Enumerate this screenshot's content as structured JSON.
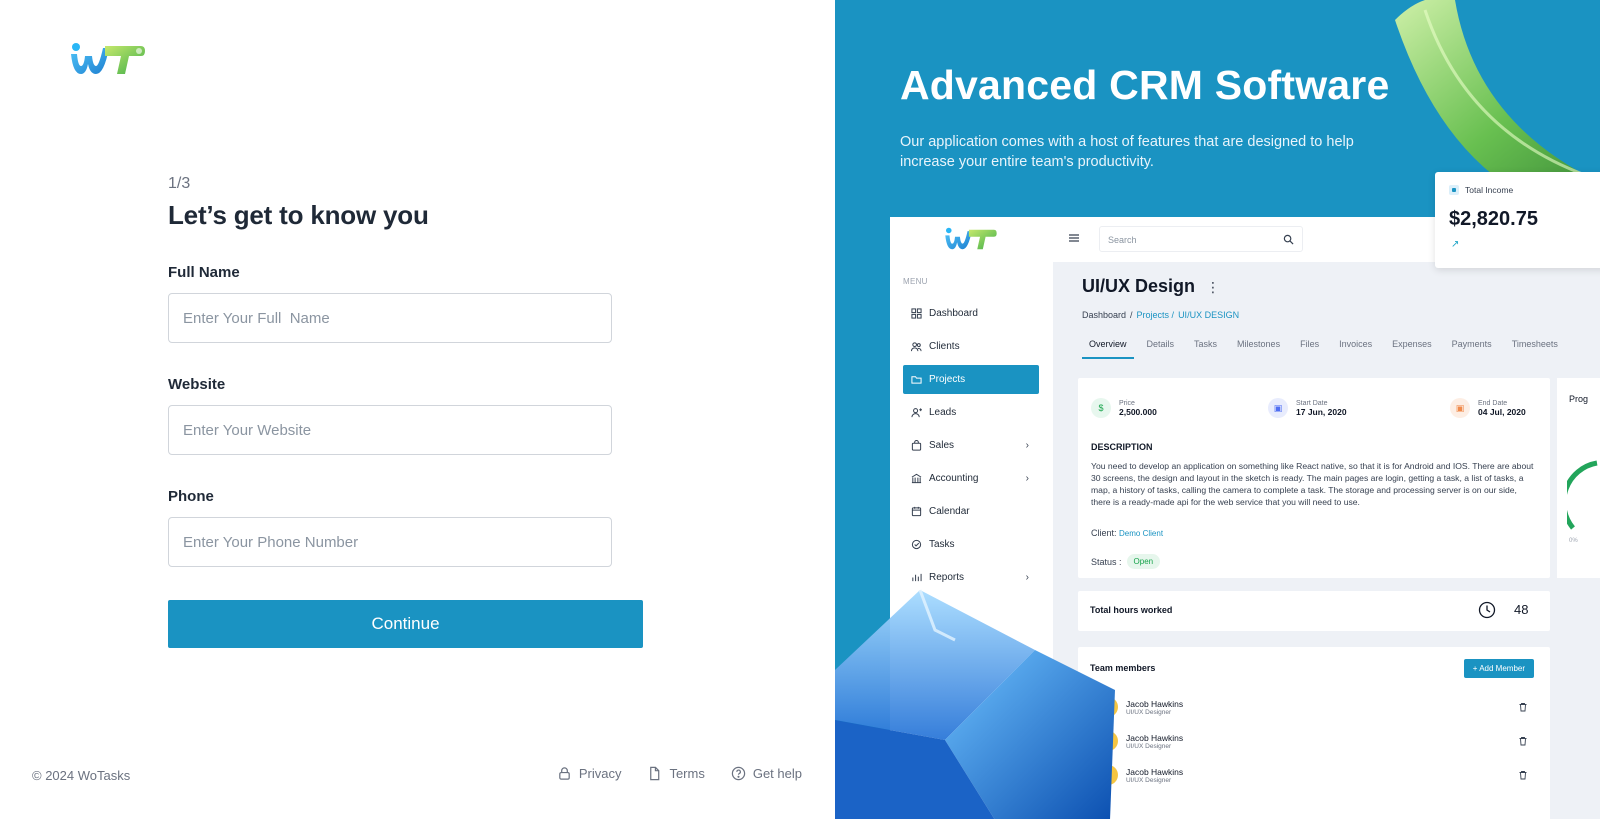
{
  "brand": {
    "logo_text": "WT",
    "copyright": "© 2024 WoTasks"
  },
  "form": {
    "step": "1/3",
    "title": "Let’s get to know you",
    "fields": [
      {
        "label": "Full Name",
        "placeholder": "Enter Your Full  Name"
      },
      {
        "label": "Website",
        "placeholder": "Enter Your Website"
      },
      {
        "label": "Phone",
        "placeholder": "Enter Your Phone Number"
      }
    ],
    "continue_label": "Continue"
  },
  "footer": {
    "links": [
      {
        "label": "Privacy",
        "icon": "lock-icon"
      },
      {
        "label": "Terms",
        "icon": "document-icon"
      },
      {
        "label": "Get help",
        "icon": "help-circle-icon"
      }
    ]
  },
  "hero": {
    "title": "Advanced CRM Software",
    "subtitle": "Our application comes with a host of features that are designed to help increase your entire team's productivity."
  },
  "mockup": {
    "menu_label": "MENU",
    "nav": [
      {
        "label": "Dashboard",
        "icon": "grid-icon",
        "active": false,
        "chevron": false
      },
      {
        "label": "Clients",
        "icon": "users-icon",
        "active": false,
        "chevron": false
      },
      {
        "label": "Projects",
        "icon": "folder-icon",
        "active": true,
        "chevron": false
      },
      {
        "label": "Leads",
        "icon": "user-plus-icon",
        "active": false,
        "chevron": false
      },
      {
        "label": "Sales",
        "icon": "bag-icon",
        "active": false,
        "chevron": true
      },
      {
        "label": "Accounting",
        "icon": "bank-icon",
        "active": false,
        "chevron": true
      },
      {
        "label": "Calendar",
        "icon": "calendar-icon",
        "active": false,
        "chevron": false
      },
      {
        "label": "Tasks",
        "icon": "check-circle-icon",
        "active": false,
        "chevron": false
      },
      {
        "label": "Reports",
        "icon": "chart-icon",
        "active": false,
        "chevron": true
      }
    ],
    "search_placeholder": "Search",
    "page_title": "UI/UX Design",
    "breadcrumb": {
      "home": "Dashboard",
      "sep": "/",
      "mid": "Projects /",
      "current": "UI/UX DESIGN"
    },
    "tabs": [
      "Overview",
      "Details",
      "Tasks",
      "Milestones",
      "Files",
      "Invoices",
      "Expenses",
      "Payments",
      "Timesheets"
    ],
    "stats": [
      {
        "label": "Price",
        "value": "2,500.000",
        "icon": "dollar-icon",
        "color": "#16a34a",
        "bg": "#e7f7ee"
      },
      {
        "label": "Start Date",
        "value": "17 Jun, 2020",
        "icon": "calendar-icon",
        "color": "#4f6ef2",
        "bg": "#e8ecfd"
      },
      {
        "label": "End Date",
        "value": "04 Jul, 2020",
        "icon": "calendar-icon",
        "color": "#f08a4b",
        "bg": "#fdeee4"
      }
    ],
    "description_title": "DESCRIPTION",
    "description": "You need to develop an application on something like React native, so that it is for Android and IOS. There are about 30 screens, the design and layout in the sketch is ready. The main pages are login, getting a task, a list of tasks, a map, a history of tasks, calling the camera to complete a task. The storage and processing server is on our side, there is a ready-made api for the web service that you will need to use.",
    "client_label": "Client:",
    "client_value": "Demo Client",
    "status_label": "Status :",
    "status_value": "Open",
    "hours_label": "Total hours worked",
    "hours_value": "48",
    "team_label": "Team members",
    "add_member_label": "+ Add Member",
    "members": [
      {
        "name": "Jacob Hawkins",
        "role": "UI/UX Designer"
      },
      {
        "name": "Jacob Hawkins",
        "role": "UI/UX Designer"
      },
      {
        "name": "Jacob Hawkins",
        "role": "UI/UX Designer"
      }
    ],
    "progress_label": "Prog",
    "progress_zero": "0%",
    "income_label": "Total Income",
    "income_value": "$2,820.75"
  },
  "colors": {
    "primary": "#1a93c2",
    "text": "#1f2937",
    "muted": "#6b7280"
  }
}
